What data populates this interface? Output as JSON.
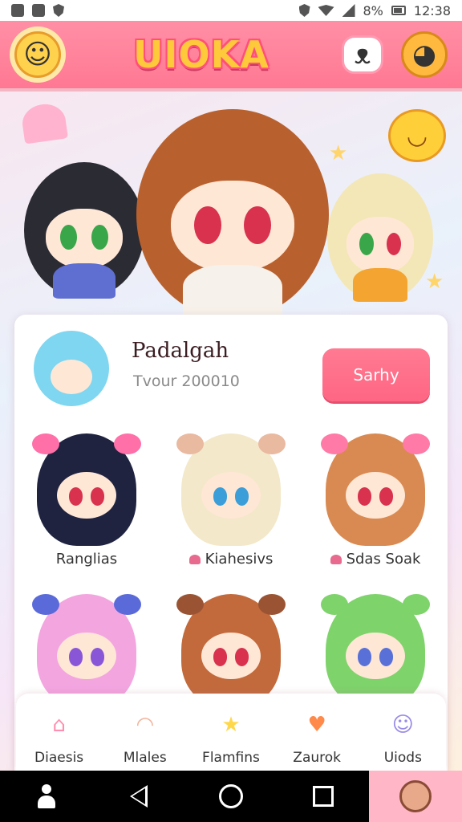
{
  "status_bar": {
    "battery": "8%",
    "time": "12:38"
  },
  "header": {
    "logo": "UIOKA"
  },
  "profile": {
    "name": "Padalgah",
    "subtitle": "Tvour 200010",
    "button_label": "Sarhy"
  },
  "characters": [
    {
      "label": "Ranglias",
      "hair": "#1f2340",
      "bow": "#ff6fa8",
      "eye": "#d8324f",
      "heart": false
    },
    {
      "label": "Kiahesivs",
      "hair": "#f3e8c9",
      "bow": "#e9b9a0",
      "eye": "#3b9ed8",
      "heart": true
    },
    {
      "label": "Sdas Soak",
      "hair": "#d98a52",
      "bow": "#ff7aa6",
      "eye": "#d8324f",
      "heart": true
    },
    {
      "label": "",
      "hair": "#f3a5e0",
      "bow": "#5a6ad9",
      "eye": "#8a56d8",
      "heart": false
    },
    {
      "label": "",
      "hair": "#c26a3c",
      "bow": "#9a5433",
      "eye": "#d8324f",
      "heart": false
    },
    {
      "label": "",
      "hair": "#7ed36b",
      "bow": "#7ed36b",
      "eye": "#5870d8",
      "heart": false
    }
  ],
  "tabs": [
    {
      "label": "Diaesis",
      "icon": "house-icon",
      "glyph": "⌂",
      "color": "#ff8fb0"
    },
    {
      "label": "Mlales",
      "icon": "bread-icon",
      "glyph": "◠",
      "color": "#f2b39b"
    },
    {
      "label": "Flamfins",
      "icon": "star-icon",
      "glyph": "★",
      "color": "#ffd84a"
    },
    {
      "label": "Zaurok",
      "icon": "heart-icon",
      "glyph": "♥",
      "color": "#ff8a4a"
    },
    {
      "label": "Uiods",
      "icon": "blob-icon",
      "glyph": "☺",
      "color": "#9a8ae8"
    }
  ],
  "hero_glyphs": {
    "sun_face": "◡",
    "star": "★"
  },
  "header_glyphs": {
    "sun": "☺",
    "cat": "ᴥ",
    "moon": "◕"
  }
}
